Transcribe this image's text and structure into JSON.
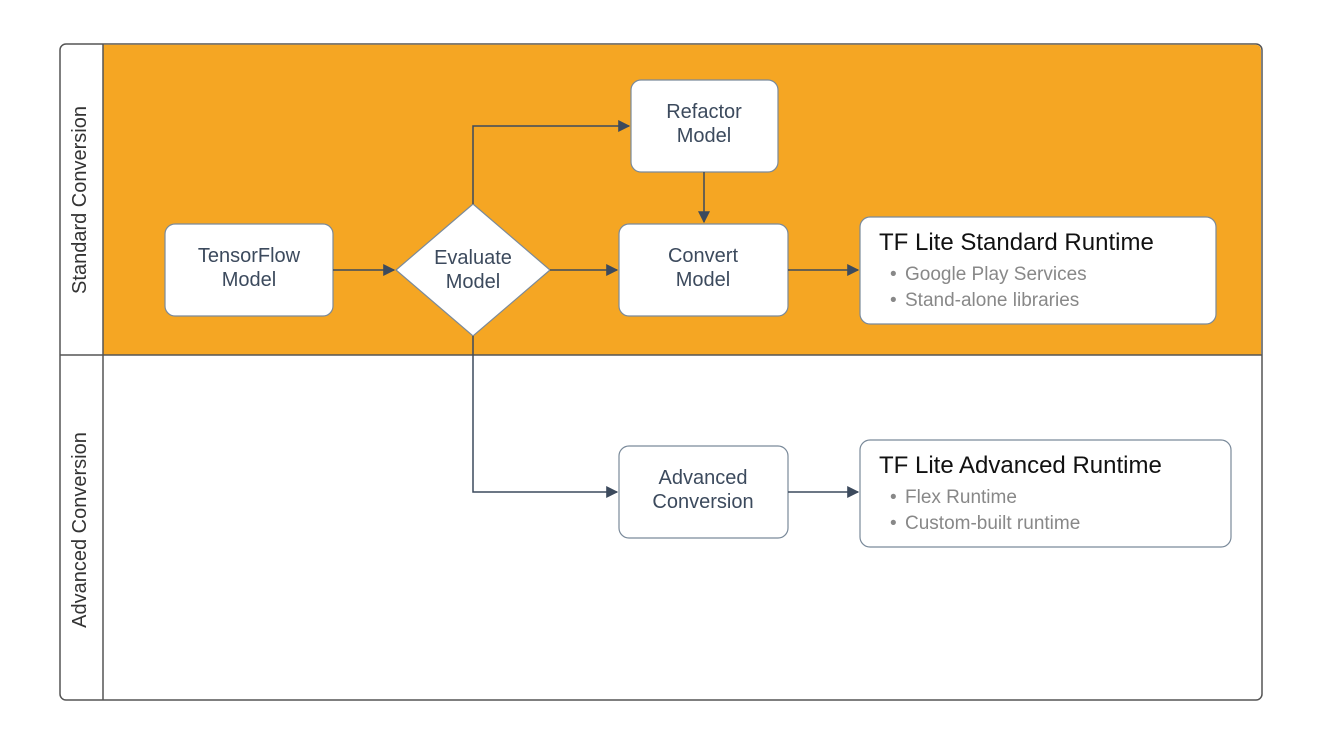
{
  "sections": {
    "top": "Standard Conversion",
    "bottom": "Advanced Conversion"
  },
  "nodes": {
    "tensorflow_model": {
      "line1": "TensorFlow",
      "line2": "Model"
    },
    "evaluate_model": {
      "line1": "Evaluate",
      "line2": "Model"
    },
    "refactor_model": {
      "line1": "Refactor",
      "line2": "Model"
    },
    "convert_model": {
      "line1": "Convert",
      "line2": "Model"
    },
    "advanced_conv": {
      "line1": "Advanced",
      "line2": "Conversion"
    },
    "std_runtime": {
      "title": "TF Lite Standard Runtime",
      "bullets": [
        "Google Play Services",
        "Stand-alone libraries"
      ]
    },
    "adv_runtime": {
      "title": "TF Lite Advanced Runtime",
      "bullets": [
        "Flex Runtime",
        "Custom-built runtime"
      ]
    }
  },
  "colors": {
    "accent": "#f5a623",
    "node_stroke": "#7a8a9a",
    "frame_stroke": "#555",
    "text_dark": "#3c4a5d",
    "bullet_gray": "#888"
  }
}
